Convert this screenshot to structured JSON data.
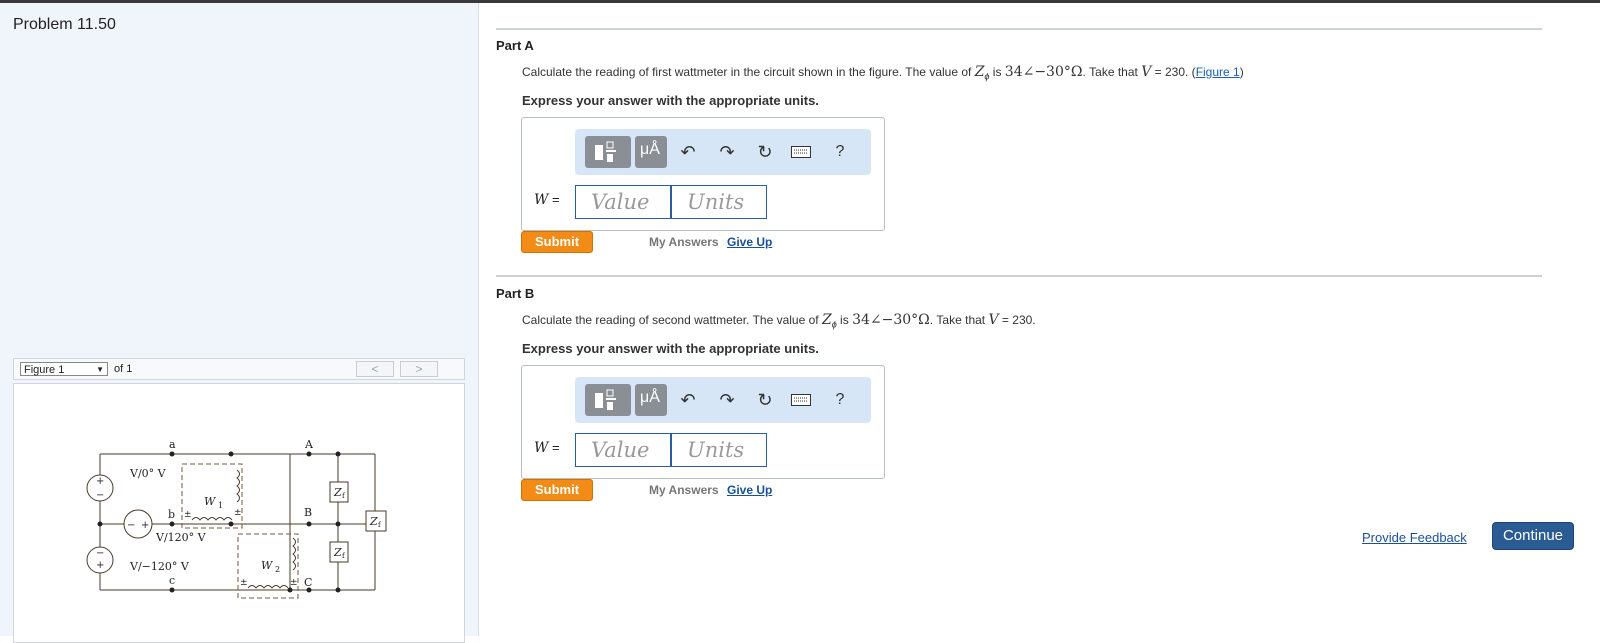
{
  "problem_title": "Problem 11.50",
  "figure_nav": {
    "select_value": "Figure 1",
    "of_text": "of 1",
    "prev": "<",
    "next": ">"
  },
  "circuit": {
    "labels": {
      "a": "a",
      "b": "b",
      "c": "c",
      "A": "A",
      "B": "B",
      "C": "C",
      "v1": "V/0° V",
      "v2": "V/120° V",
      "v3": "V/−120° V",
      "w1": "W",
      "w1_sub": "1",
      "w2": "W",
      "w2_sub": "2",
      "z": "Z",
      "z_sub": "f",
      "pm": "±",
      "plus": "+",
      "minus": "−"
    }
  },
  "parts": [
    {
      "title": "Part A",
      "question_pre": "Calculate the reading of first wattmeter in the circuit shown in the figure. The value of ",
      "z_symbol": "Z",
      "z_sub": "ϕ",
      "is_text": " is ",
      "z_value": "34∠−30°Ω",
      "take_text": ". Take that ",
      "v_symbol": "V",
      "v_value": " = 230. (",
      "figure_link": "Figure 1",
      "close": ")",
      "express": "Express your answer with the appropriate units.",
      "answer_label": "W",
      "equals": " =",
      "value_placeholder": "Value",
      "units_placeholder": "Units",
      "submit": "Submit",
      "my_answers": "My Answers",
      "give_up": "Give Up"
    },
    {
      "title": "Part B",
      "question_pre": "Calculate the reading of second wattmeter. The value of ",
      "z_symbol": "Z",
      "z_sub": "ϕ",
      "is_text": " is ",
      "z_value": "34∠−30°Ω",
      "take_text": ". Take that ",
      "v_symbol": "V",
      "v_value": " = 230.",
      "express": "Express your answer with the appropriate units.",
      "answer_label": "W",
      "equals": " =",
      "value_placeholder": "Value",
      "units_placeholder": "Units",
      "submit": "Submit",
      "my_answers": "My Answers",
      "give_up": "Give Up"
    }
  ],
  "toolbar": {
    "units_btn": "μÅ",
    "help": "?"
  },
  "footer": {
    "feedback": "Provide Feedback",
    "continue": "Continue"
  }
}
